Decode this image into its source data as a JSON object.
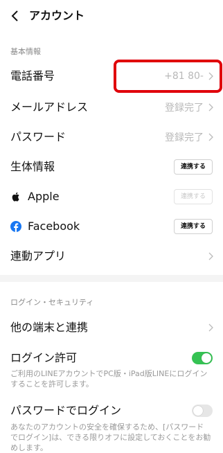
{
  "header": {
    "title": "アカウント"
  },
  "sections": {
    "basic_info": "基本情報",
    "login_security": "ログイン・セキュリティ"
  },
  "rows": {
    "phone": {
      "label": "電話番号",
      "value": "+81 80-"
    },
    "email": {
      "label": "メールアドレス",
      "value": "登録完了"
    },
    "password": {
      "label": "パスワード",
      "value": "登録完了"
    },
    "biometric": {
      "label": "生体情報",
      "button": "連携する"
    },
    "apple": {
      "label": "Apple",
      "button": "連携する"
    },
    "facebook": {
      "label": "Facebook",
      "button": "連携する"
    },
    "linked_apps": {
      "label": "連動アプリ"
    },
    "other_devices": {
      "label": "他の端末と連携"
    },
    "login_permission": {
      "label": "ログイン許可",
      "description": "ご利用のLINEアカウントでPC版・iPad版LINEにログインすることを許可します。",
      "enabled": true
    },
    "password_login": {
      "label": "パスワードでログイン",
      "description": "あなたのアカウントの安全を確保するため、[パスワードでログイン]は、できる限りオフに設定しておくことをお勧めします。",
      "enabled": false
    }
  },
  "colors": {
    "accent_green": "#35c253",
    "highlight_red": "#e0000a",
    "facebook_blue": "#1877f2"
  }
}
